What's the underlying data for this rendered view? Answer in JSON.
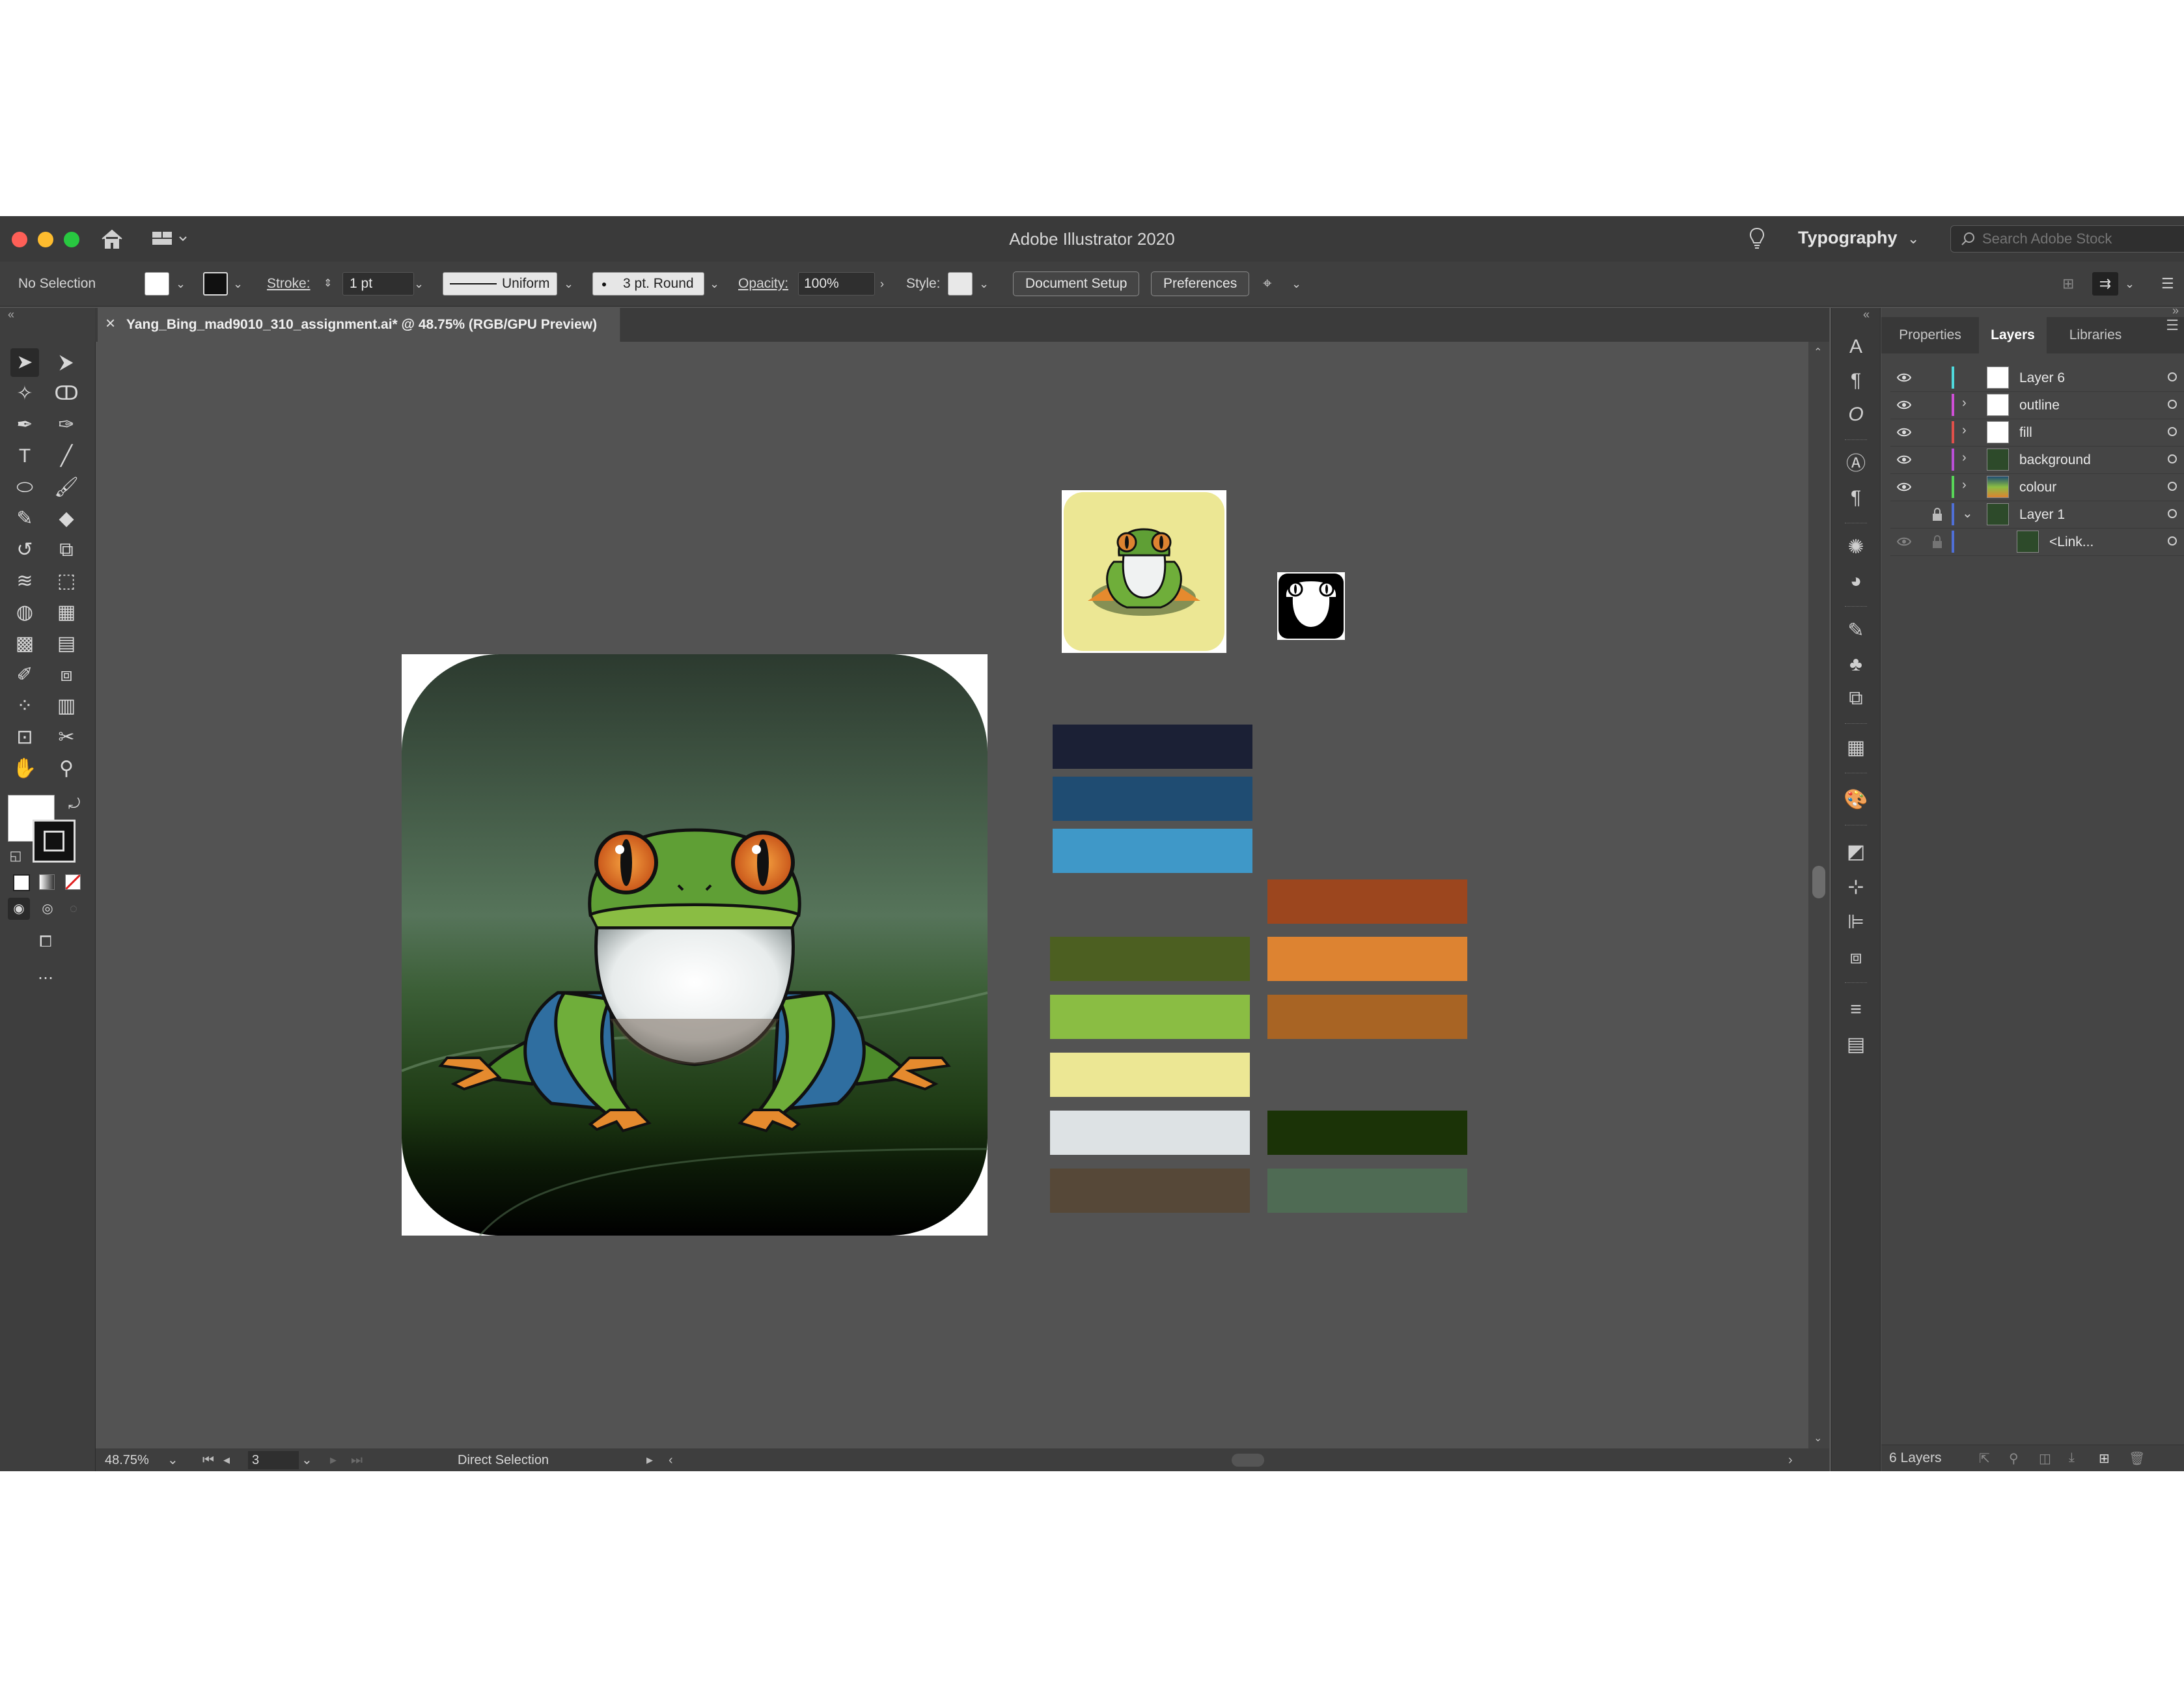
{
  "window": {
    "app_title": "Adobe Illustrator 2020",
    "workspace": "Typography",
    "search_placeholder": "Search Adobe Stock"
  },
  "control_bar": {
    "selection": "No Selection",
    "stroke_label": "Stroke:",
    "stroke_weight": "1 pt",
    "stroke_profile": "Uniform",
    "brush": "3 pt. Round",
    "opacity_label": "Opacity:",
    "opacity_value": "100%",
    "style_label": "Style:",
    "document_setup": "Document Setup",
    "preferences": "Preferences"
  },
  "document": {
    "tab_title": "Yang_Bing_mad9010_310_assignment.ai* @ 48.75% (RGB/GPU Preview)"
  },
  "status_bar": {
    "zoom": "48.75%",
    "artboard": "3",
    "tool": "Direct Selection"
  },
  "swatches": {
    "left_column": [
      "#1b2035",
      "#1f4c72",
      "#3f98c8",
      "#4c5f21",
      "#8abd43",
      "#ece794",
      "#dde2e4",
      "#564838"
    ],
    "right_column": [
      "#9c461e",
      "#dd8331",
      "#a86424",
      "#1b3307",
      "#4f6b54"
    ]
  },
  "panels": {
    "tabs": [
      "Properties",
      "Layers",
      "Libraries"
    ],
    "active_tab": "Layers",
    "layers": [
      {
        "name": "Layer 6",
        "color": "#4fd9dc",
        "visible": true,
        "locked": false,
        "expand": ""
      },
      {
        "name": "outline",
        "color": "#cf4fd6",
        "visible": true,
        "locked": false,
        "expand": "›"
      },
      {
        "name": "fill",
        "color": "#e0504a",
        "visible": true,
        "locked": false,
        "expand": "›"
      },
      {
        "name": "background",
        "color": "#b94fd6",
        "visible": true,
        "locked": false,
        "expand": "›"
      },
      {
        "name": "colour",
        "color": "#58d658",
        "visible": true,
        "locked": false,
        "expand": "›"
      },
      {
        "name": "Layer 1",
        "color": "#4f6fd6",
        "visible": false,
        "locked": true,
        "expand": "⌄"
      },
      {
        "name": "<Link...",
        "color": "#4f6fd6",
        "visible": false,
        "locked": true,
        "expand": ""
      }
    ],
    "layer_count": "6 Layers"
  },
  "colors": {
    "ui_bg": "#535353",
    "panel_bg": "#454545",
    "close": "#fe5f57",
    "minimize": "#febc2e",
    "zoom": "#28c840"
  }
}
